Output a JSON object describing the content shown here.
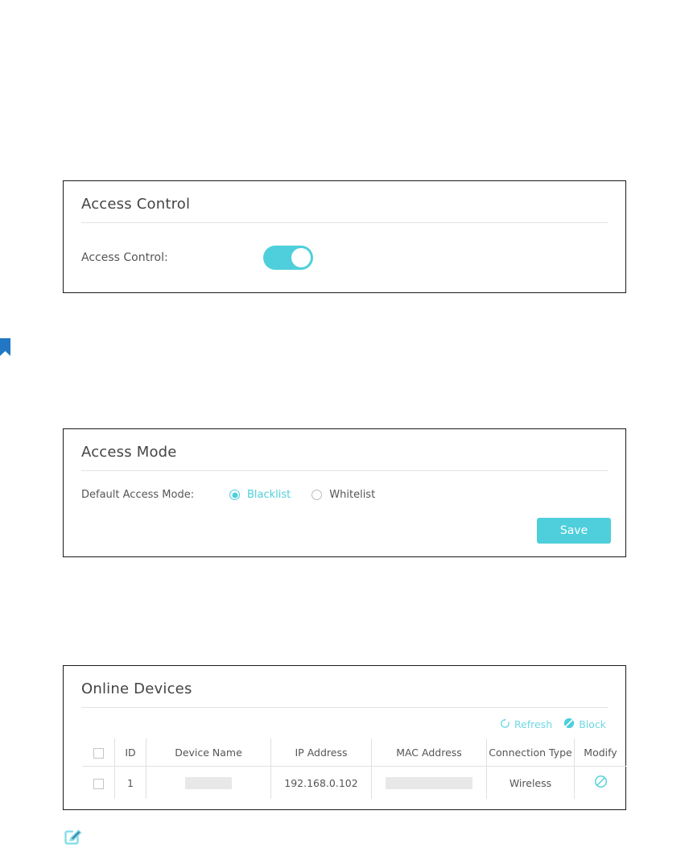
{
  "theme": {
    "accent": "#4ecfdb",
    "accent_light": "#6fd9e3",
    "bookmark_blue": "#2277c4",
    "text": "#444444",
    "redact_gray": "#e8e8e8"
  },
  "access_control_panel": {
    "title": "Access Control",
    "field_label": "Access Control:",
    "toggle": {
      "name": "access-control-toggle",
      "state": "on"
    }
  },
  "bookmark_marker": {
    "icon": "bookmark-icon"
  },
  "access_mode_panel": {
    "title": "Access Mode",
    "field_label": "Default Access Mode:",
    "options": [
      {
        "label": "Blacklist",
        "selected": true
      },
      {
        "label": "Whitelist",
        "selected": false
      }
    ],
    "save_label": "Save"
  },
  "online_devices_panel": {
    "title": "Online Devices",
    "actions": [
      {
        "label": "Refresh",
        "icon": "refresh-icon"
      },
      {
        "label": "Block",
        "icon": "block-filled-icon"
      }
    ],
    "table": {
      "columns": [
        "",
        "ID",
        "Device Name",
        "IP Address",
        "MAC Address",
        "Connection Type",
        "Modify"
      ],
      "rows": [
        {
          "id": "1",
          "device_name": "",
          "device_name_redacted": true,
          "ip_address": "192.168.0.102",
          "mac_address": "",
          "mac_address_redacted": true,
          "connection_type": "Wireless",
          "modify_icon": "block-outline-icon"
        }
      ]
    }
  },
  "note_marker": {
    "icon": "edit-note-icon"
  }
}
